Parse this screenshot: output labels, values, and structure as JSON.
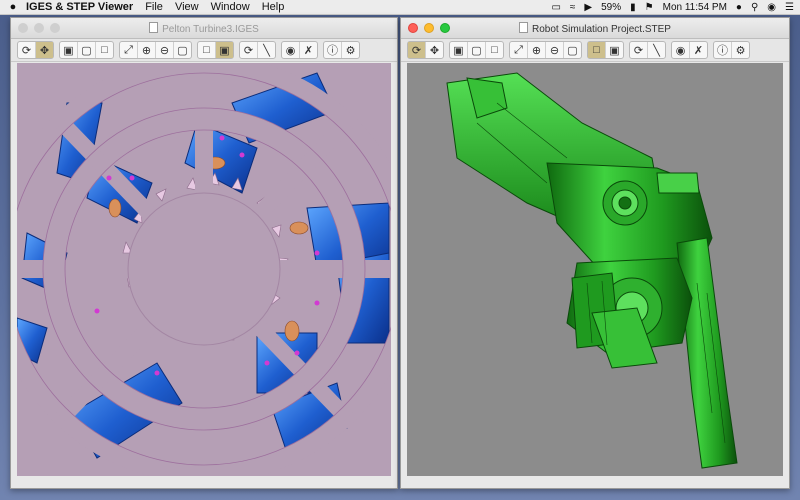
{
  "menubar": {
    "apple": "",
    "app_name": "IGES & STEP Viewer",
    "items": [
      "File",
      "View",
      "Window",
      "Help"
    ],
    "battery": "59%",
    "clock": "Mon 11:54 PM"
  },
  "windows": {
    "left": {
      "title": "Pelton Turbine3.IGES",
      "active": false
    },
    "right": {
      "title": "Robot Simulation Project.STEP",
      "active": true
    }
  },
  "toolbar_icons": {
    "group1": [
      "rotate-icon",
      "pan-icon"
    ],
    "group2": [
      "box-front-icon",
      "box-side-icon",
      "box-top-icon"
    ],
    "group3": [
      "fit-all-icon",
      "zoom-in-icon",
      "zoom-out-icon",
      "zoom-window-icon"
    ],
    "group4": [
      "wireframe-icon",
      "shaded-icon"
    ],
    "group5": [
      "spin-icon",
      "ruler-icon"
    ],
    "group6": [
      "show-icon",
      "hide-icon"
    ],
    "group7": [
      "info-icon",
      "settings-icon"
    ]
  },
  "colors": {
    "left_viewport": "#b59fb5",
    "right_viewport": "#8c8c8c",
    "model_green": "#2fb02f",
    "model_blue": "#2a6fd6",
    "active_tool": "#cdbf8c"
  }
}
